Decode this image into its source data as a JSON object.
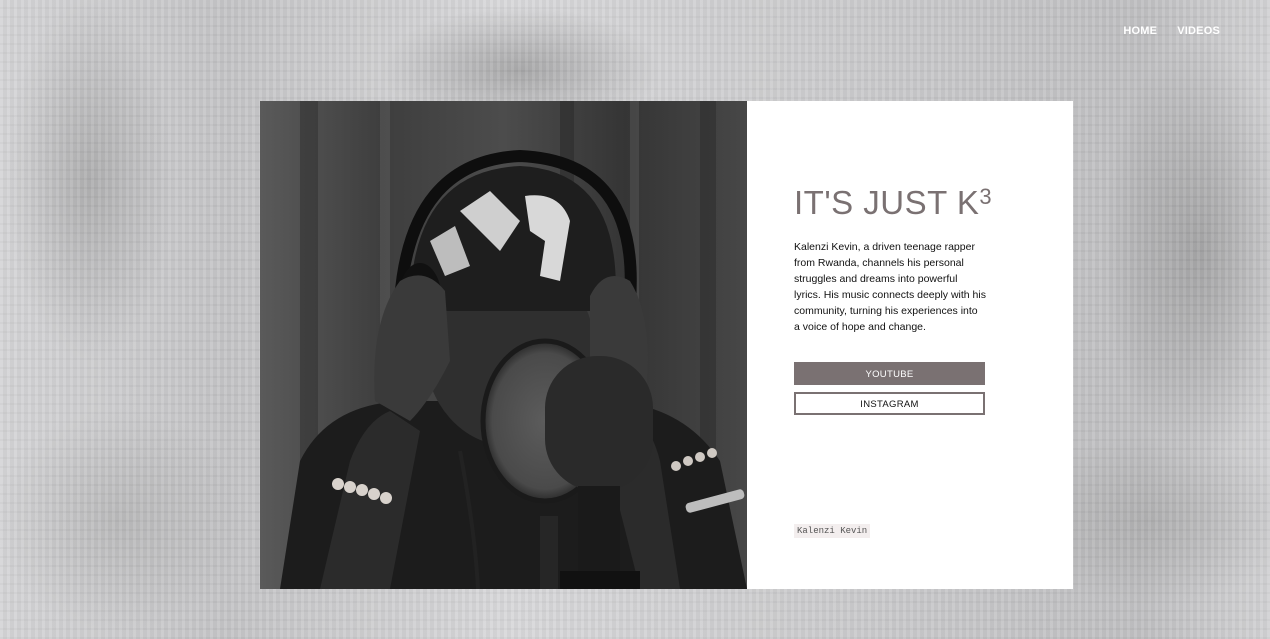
{
  "nav": {
    "items": [
      {
        "label": "HOME"
      },
      {
        "label": "VIDEOS"
      }
    ]
  },
  "hero": {
    "title": "IT'S JUST K",
    "title_superscript": "3",
    "bio": "Kalenzi Kevin, a driven teenage rapper from Rwanda, channels his personal struggles and dreams into powerful lyrics. His music connects deeply with his community, turning his experiences into a voice of hope and change.",
    "buttons": {
      "youtube": "YOUTUBE",
      "instagram": "INSTAGRAM"
    },
    "credit": "Kalenzi Kevin"
  },
  "colors": {
    "accent": "#7a7172",
    "card_bg": "#ffffff",
    "page_bg": "#cfcfd1"
  }
}
